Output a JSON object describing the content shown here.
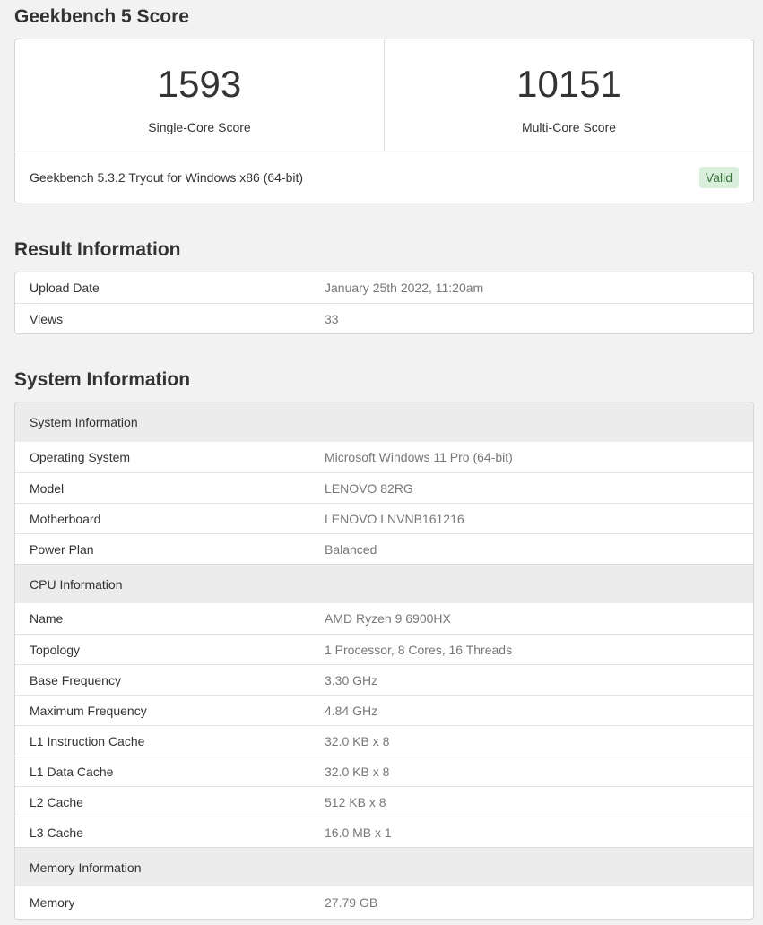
{
  "score": {
    "title": "Geekbench 5 Score",
    "single_value": "1593",
    "single_label": "Single-Core Score",
    "multi_value": "10151",
    "multi_label": "Multi-Core Score",
    "version_text": "Geekbench 5.3.2 Tryout for Windows x86 (64-bit)",
    "valid_label": "Valid"
  },
  "result": {
    "title": "Result Information",
    "rows": [
      {
        "key": "Upload Date",
        "value": "January 25th 2022, 11:20am"
      },
      {
        "key": "Views",
        "value": "33"
      }
    ]
  },
  "system": {
    "title": "System Information",
    "sections": [
      {
        "header": "System Information",
        "rows": [
          {
            "key": "Operating System",
            "value": "Microsoft Windows 11 Pro (64-bit)"
          },
          {
            "key": "Model",
            "value": "LENOVO 82RG"
          },
          {
            "key": "Motherboard",
            "value": "LENOVO LNVNB161216"
          },
          {
            "key": "Power Plan",
            "value": "Balanced"
          }
        ]
      },
      {
        "header": "CPU Information",
        "rows": [
          {
            "key": "Name",
            "value": "AMD Ryzen 9 6900HX"
          },
          {
            "key": "Topology",
            "value": "1 Processor, 8 Cores, 16 Threads"
          },
          {
            "key": "Base Frequency",
            "value": "3.30 GHz"
          },
          {
            "key": "Maximum Frequency",
            "value": "4.84 GHz"
          },
          {
            "key": "L1 Instruction Cache",
            "value": "32.0 KB x 8"
          },
          {
            "key": "L1 Data Cache",
            "value": "32.0 KB x 8"
          },
          {
            "key": "L2 Cache",
            "value": "512 KB x 8"
          },
          {
            "key": "L3 Cache",
            "value": "16.0 MB x 1"
          }
        ]
      },
      {
        "header": "Memory Information",
        "rows": [
          {
            "key": "Memory",
            "value": "27.79 GB"
          }
        ]
      }
    ]
  },
  "colors": {
    "background": "#f2f2f2",
    "valid_badge_bg": "#d9eedb",
    "valid_badge_text": "#3c763d",
    "value_text": "#777777"
  }
}
